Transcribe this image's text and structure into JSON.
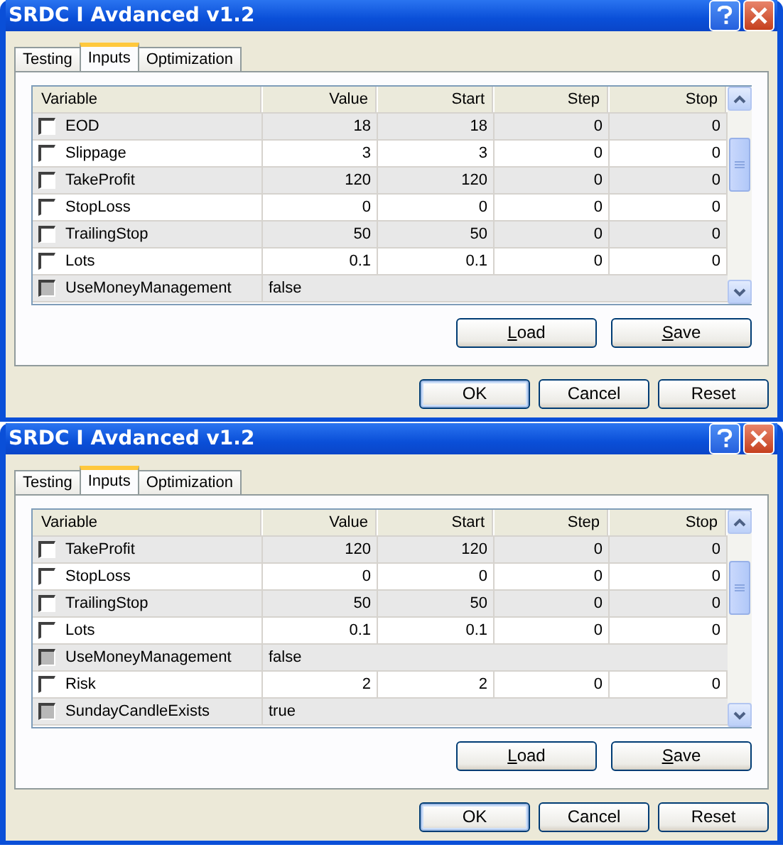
{
  "dialogs": [
    {
      "title": "SRDC I Avdanced v1.2",
      "tabs": [
        {
          "label": "Testing",
          "selected": false
        },
        {
          "label": "Inputs",
          "selected": true
        },
        {
          "label": "Optimization",
          "selected": false
        }
      ],
      "columns": [
        "Variable",
        "Value",
        "Start",
        "Step",
        "Stop"
      ],
      "rows": [
        {
          "kind": "number",
          "checked": false,
          "cells": [
            "EOD",
            "18",
            "18",
            "0",
            "0"
          ]
        },
        {
          "kind": "number",
          "checked": false,
          "cells": [
            "Slippage",
            "3",
            "3",
            "0",
            "0"
          ]
        },
        {
          "kind": "number",
          "checked": false,
          "cells": [
            "TakeProfit",
            "120",
            "120",
            "0",
            "0"
          ]
        },
        {
          "kind": "number",
          "checked": false,
          "cells": [
            "StopLoss",
            "0",
            "0",
            "0",
            "0"
          ]
        },
        {
          "kind": "number",
          "checked": false,
          "cells": [
            "TrailingStop",
            "50",
            "50",
            "0",
            "0"
          ]
        },
        {
          "kind": "number",
          "checked": false,
          "cells": [
            "Lots",
            "0.1",
            "0.1",
            "0",
            "0"
          ]
        },
        {
          "kind": "bool",
          "checked": false,
          "cells": [
            "UseMoneyManagement",
            "false"
          ]
        }
      ],
      "panel_buttons": [
        "Load",
        "Save"
      ],
      "buttons": [
        "OK",
        "Cancel",
        "Reset"
      ]
    },
    {
      "title": "SRDC I Avdanced v1.2",
      "tabs": [
        {
          "label": "Testing",
          "selected": false
        },
        {
          "label": "Inputs",
          "selected": true
        },
        {
          "label": "Optimization",
          "selected": false
        }
      ],
      "columns": [
        "Variable",
        "Value",
        "Start",
        "Step",
        "Stop"
      ],
      "rows": [
        {
          "kind": "number",
          "checked": false,
          "cells": [
            "TakeProfit",
            "120",
            "120",
            "0",
            "0"
          ]
        },
        {
          "kind": "number",
          "checked": false,
          "cells": [
            "StopLoss",
            "0",
            "0",
            "0",
            "0"
          ]
        },
        {
          "kind": "number",
          "checked": false,
          "cells": [
            "TrailingStop",
            "50",
            "50",
            "0",
            "0"
          ]
        },
        {
          "kind": "number",
          "checked": false,
          "cells": [
            "Lots",
            "0.1",
            "0.1",
            "0",
            "0"
          ]
        },
        {
          "kind": "bool",
          "checked": false,
          "cells": [
            "UseMoneyManagement",
            "false"
          ]
        },
        {
          "kind": "number",
          "checked": false,
          "cells": [
            "Risk",
            "2",
            "2",
            "0",
            "0"
          ]
        },
        {
          "kind": "bool",
          "checked": false,
          "cells": [
            "SundayCandleExists",
            "true"
          ]
        }
      ],
      "panel_buttons": [
        "Load",
        "Save"
      ],
      "buttons": [
        "OK",
        "Cancel",
        "Reset"
      ]
    }
  ]
}
